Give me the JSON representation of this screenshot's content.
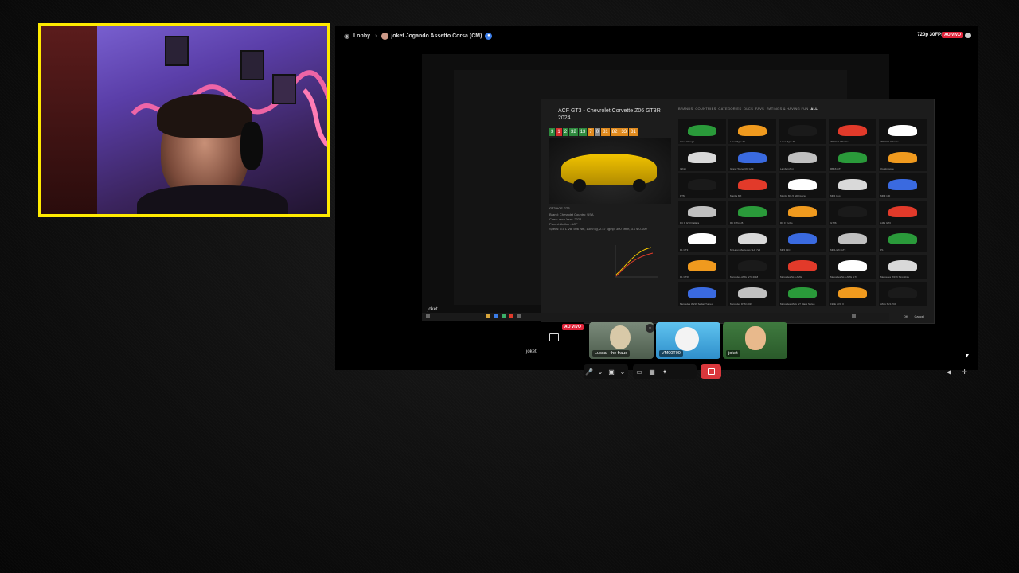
{
  "window": {
    "breadcrumb_lobby": "Lobby",
    "streamer_title": "joket Jogando Assetto Corsa (CM)",
    "quality": "720p 30FPS",
    "live_badge": "AO VIVO"
  },
  "shared_screen": {
    "modal_title": "ACF GT3 - Chevrolet Corvette Z06 GT3R 2024",
    "badges": [
      "3",
      "1",
      "2",
      "32",
      "13",
      "7",
      "0",
      "81",
      "82",
      "33",
      "81"
    ],
    "spec_tabs": "GT3   ACF   GT3",
    "specs": [
      "Brand: Chevrolet          Country: USA",
      "Class: race               Year: 2024",
      "Parent:                   Author: ACF",
      "Specs: 5.5 L V8, 596 Nm, 1309 kg, 2.47 kg/hp, 300 km/h, 3.1 s 0-100"
    ],
    "filters": [
      "BRANDS",
      "COUNTRIES",
      "CATEGORIES",
      "DLCS",
      "FAVS",
      "RATINGS & HAVING FUN"
    ],
    "filter_active": "ALL",
    "cars": [
      "Lotus Omega",
      "Lotus Type 25",
      "Lotus Type 49",
      "2007 F1 Ultimate",
      "2007 F1 Ultimate",
      "Infiniti",
      "Grand Tourer RC GT3",
      "Lamborghini",
      "RB16 GT3",
      "Quattroporte",
      "DTM",
      "Mazda MX",
      "Mazda MX-5 ND Inverso",
      "MP4 Cup",
      "MINI 100",
      "RC F GT3 Dallara",
      "RC F Tipo B",
      "RC F Turbo",
      "GT86",
      "LMS GT3",
      "P1 GT3",
      "McLaren Mercedes SLR 722",
      "MP4 12C",
      "MP4-12C GT3",
      "P1",
      "P1 GTR",
      "Mercedes-AMG GT3 2018",
      "Mercedes SLS AMG",
      "Mercedes SLS AMG GT3",
      "Mercedes W196 Stromlinie",
      "Mercedes W219 Sedan Turned",
      "Mercedes DTM 2019",
      "Mercedes-AMG GT Black Series",
      "190E EVO II",
      "AMG SLS TCP"
    ],
    "ok_label": "OK",
    "cancel_label": "Cancel",
    "shared_user": "joket"
  },
  "participants": {
    "self_name": "joket",
    "self_live": "AO VIVO",
    "users": [
      "Lusca - the fraud",
      "VM00T00",
      "joket"
    ]
  }
}
